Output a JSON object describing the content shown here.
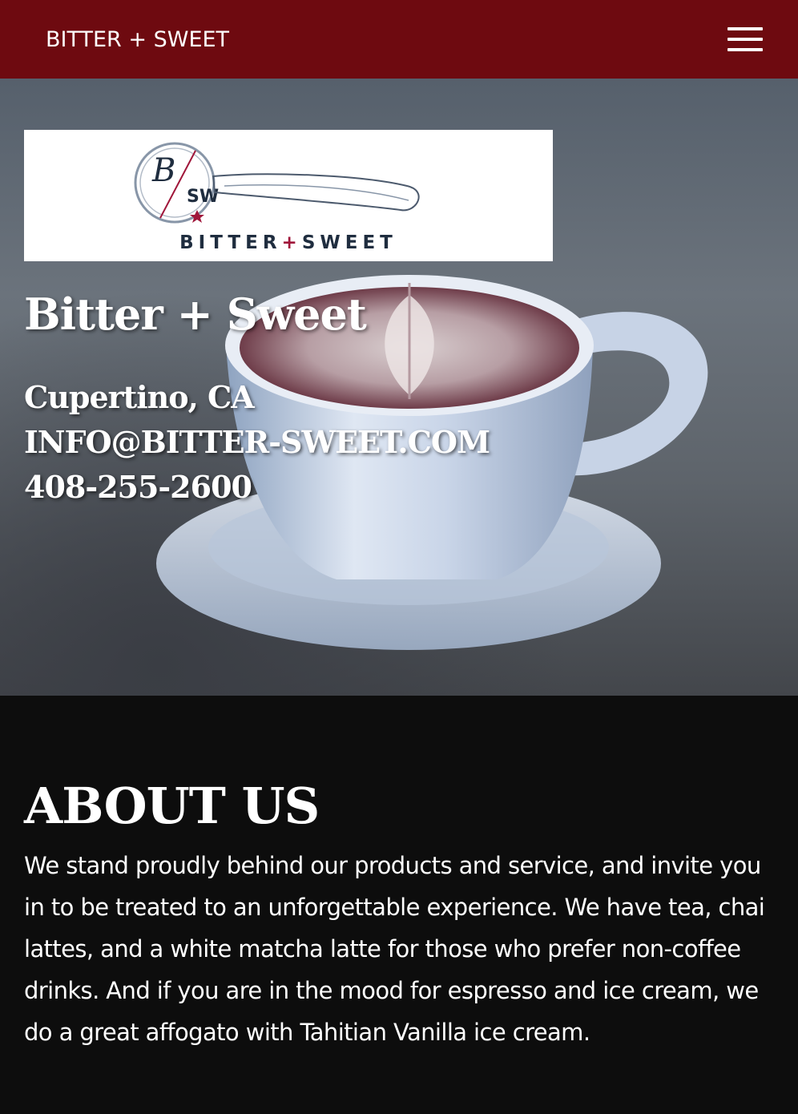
{
  "nav": {
    "brand": "BITTER + SWEET",
    "menu_icon": "hamburger-menu-icon"
  },
  "hero": {
    "logo": {
      "monogram_top": "B",
      "monogram_bottom": "SW",
      "wordmark_left": "BITTER",
      "wordmark_plus": "+",
      "wordmark_right": "SWEET"
    },
    "title": "Bitter + Sweet",
    "location": "Cupertino, CA",
    "email": "INFO@BITTER-SWEET.COM",
    "phone": "408-255-2600"
  },
  "about": {
    "heading": "ABOUT US",
    "body": "We stand proudly behind our products and service, and invite you in to be treated to an unforgettable experience. We have tea, chai lattes, and a white matcha latte for those who prefer non-coffee drinks. And if you are in the mood for espresso and ice cream, we do a great affogato with Tahitian Vanilla ice cream."
  },
  "colors": {
    "navbar": "#6e0a10",
    "about_bg": "#0d0d0d",
    "logo_navy": "#1f2d3f",
    "logo_accent": "#a0163a"
  }
}
